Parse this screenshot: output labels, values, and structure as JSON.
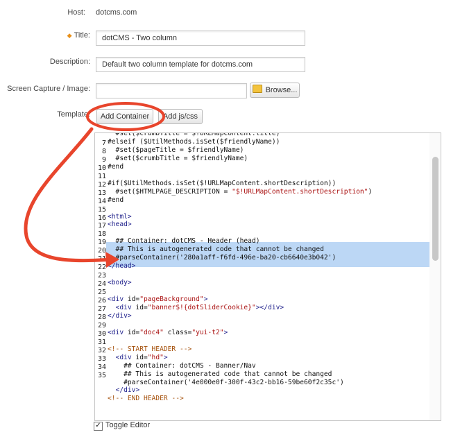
{
  "form": {
    "host_label": "Host:",
    "host_value": "dotcms.com",
    "title_label": "Title:",
    "title_value": "dotCMS - Two column",
    "description_label": "Description:",
    "description_value": "Default two column template for dotcms.com",
    "screen_capture_label": "Screen Capture / Image:",
    "browse_label": "Browse...",
    "template_label": "Template:",
    "add_container_label": "Add Container",
    "add_jscss_label": "Add js/css",
    "toggle_editor_label": "Toggle Editor",
    "toggle_editor_checked": true
  },
  "editor": {
    "lines": [
      {
        "n": "",
        "t": "  #set($crumbTitle = $!URLMapContent.title)"
      },
      {
        "n": "7",
        "t": "#elseif ($UtilMethods.isSet($friendlyName))"
      },
      {
        "n": "8",
        "t": "  #set($pageTitle = $friendlyName)"
      },
      {
        "n": "9",
        "t": "  #set($crumbTitle = $friendlyName)"
      },
      {
        "n": "10",
        "t": "#end"
      },
      {
        "n": "11",
        "t": ""
      },
      {
        "n": "12",
        "t": "#if($UtilMethods.isSet($!URLMapContent.shortDescription))"
      },
      {
        "n": "13",
        "t": "  #set($HTMLPAGE_DESCRIPTION = \"$!URLMapContent.shortDescription\")"
      },
      {
        "n": "14",
        "t": "#end"
      },
      {
        "n": "15",
        "t": ""
      },
      {
        "n": "16",
        "t": "<html>"
      },
      {
        "n": "17",
        "t": "<head>"
      },
      {
        "n": "18",
        "t": ""
      },
      {
        "n": "19",
        "t": "  ## Container: dotCMS - Header (head)"
      },
      {
        "n": "20",
        "t": "  ## This is autogenerated code that cannot be changed"
      },
      {
        "n": "21",
        "t": "  #parseContainer('280a1aff-f6fd-496e-ba20-cb6640e3b042')"
      },
      {
        "n": "22",
        "t": "</head>"
      },
      {
        "n": "23",
        "t": ""
      },
      {
        "n": "24",
        "t": "<body>"
      },
      {
        "n": "25",
        "t": ""
      },
      {
        "n": "26",
        "t": "<div id=\"pageBackground\">"
      },
      {
        "n": "27",
        "t": "  <div id=\"banner$!{dotSliderCookie}\"></div>"
      },
      {
        "n": "28",
        "t": "</div>"
      },
      {
        "n": "29",
        "t": ""
      },
      {
        "n": "30",
        "t": "<div id=\"doc4\" class=\"yui-t2\">"
      },
      {
        "n": "31",
        "t": ""
      },
      {
        "n": "32",
        "t": "<!-- START HEADER -->"
      },
      {
        "n": "33",
        "t": "  <div id=\"hd\">"
      },
      {
        "n": "34",
        "t": "    ## Container: dotCMS - Banner/Nav"
      },
      {
        "n": "35",
        "t": "    ## This is autogenerated code that cannot be changed"
      },
      {
        "n": "",
        "t": "    #parseContainer('4e000e0f-300f-43c2-bb16-59be60f2c35c')"
      },
      {
        "n": "",
        "t": "  </div>"
      },
      {
        "n": "",
        "t": "<!-- END HEADER -->"
      }
    ]
  },
  "annotation": {
    "color": "#e8452c"
  }
}
